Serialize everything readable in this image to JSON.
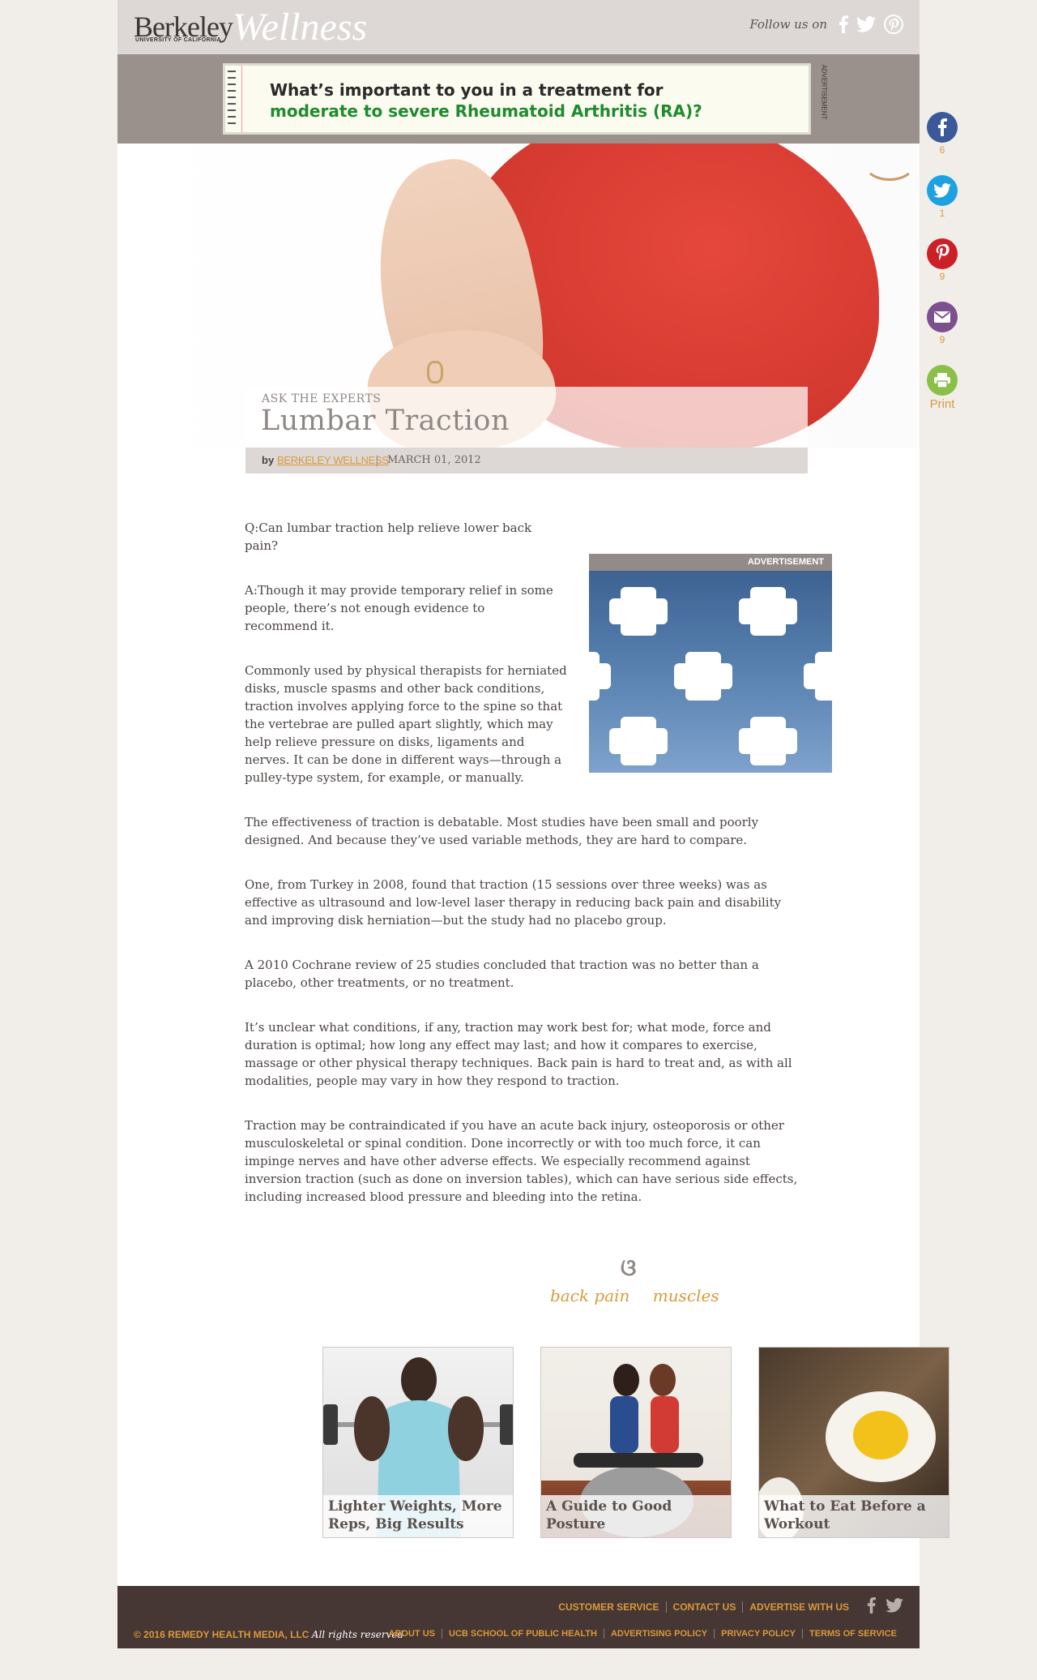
{
  "header": {
    "logo_berkeley": "Berkeley",
    "logo_sub": "UNIVERSITY OF CALIFORNIA",
    "logo_wellness": "Wellness",
    "follow_label": "Follow us on",
    "social_icons": [
      "facebook-icon",
      "twitter-icon",
      "pinterest-icon"
    ]
  },
  "top_ad": {
    "line1": "What’s important to you in a treatment for",
    "line2": "moderate to severe Rheumatoid Arthritis (RA)?",
    "side_label": "ADVERTISEMENT",
    "colors": {
      "line1": "#2a2a2a",
      "line2": "#1f8a2e"
    }
  },
  "share": {
    "facebook_count": "6",
    "twitter_count": "1",
    "pinterest_count": "9",
    "email_count": "9",
    "print_label": "Print",
    "colors": {
      "facebook": "#3b5998",
      "twitter": "#1da1e1",
      "pinterest": "#cb2027",
      "email": "#7c4f8e",
      "print": "#8bbf47"
    }
  },
  "article": {
    "kicker": "ASK THE EXPERTS",
    "title": "Lumbar Traction",
    "by": "by",
    "author": "BERKELEY WELLNESS",
    "separator": "|",
    "date": "MARCH 01, 2012",
    "paragraphs": [
      "Q:Can lumbar traction help relieve lower back pain?",
      "A:Though it may provide temporary relief in some people, there’s not enough evidence to recommend it.",
      "Commonly used by physical therapists for herniated disks, muscle spasms and other back conditions, traction involves applying force to the spine so that the vertebrae are pulled apart slightly, which may help relieve pressure on disks, ligaments and nerves. It can be done in different ways—through a pulley-type system, for example, or manually.",
      "The effectiveness of traction is debatable. Most studies have been small and poorly designed. And because they’ve used variable methods, they are hard to compare.",
      "One, from Turkey in 2008, found that traction (15 sessions over three weeks) was as effective as ultrasound and low-level laser therapy in reducing back pain and disability and improving disk herniation—but the study had no placebo group.",
      "A 2010 Cochrane review of 25 studies concluded that traction was no better than a placebo, other treatments, or no treatment.",
      "It’s unclear what conditions, if any, traction may work best for; what mode, force and duration is optimal; how long any effect may last; and how it compares to exercise, massage or other physical therapy techniques. Back pain is hard to treat and, as with all modalities, people may vary in how they respond to traction.",
      "Traction may be contraindicated if you have an acute back injury, osteoporosis or other musculoskeletal or spinal condition. Done incorrectly or with too much force, it can impinge nerves and have other adverse effects. We especially recommend against inversion traction (such as done on inversion tables), which can have serious side effects, including increased blood pressure and bleeding into the retina."
    ]
  },
  "side_ad": {
    "label": "ADVERTISEMENT"
  },
  "ornament": "ଓ",
  "tags": [
    "back pain",
    "muscles"
  ],
  "related": [
    {
      "title": "Lighter Weights, More Reps, Big Results"
    },
    {
      "title": "A Guide to Good Posture"
    },
    {
      "title": "What to Eat Before a Workout"
    }
  ],
  "footer": {
    "top_links": [
      "CUSTOMER SERVICE",
      "CONTACT US",
      "ADVERTISE WITH US"
    ],
    "bottom_links": [
      "ABOUT US",
      "UCB SCHOOL OF PUBLIC HEALTH",
      "ADVERTISING POLICY",
      "PRIVACY POLICY",
      "TERMS OF SERVICE"
    ],
    "copyright_symbol": "© 2016",
    "company": "REMEDY HEALTH MEDIA, LLC",
    "rights": "All rights reserved",
    "social_icons": [
      "facebook-icon",
      "twitter-icon"
    ]
  }
}
